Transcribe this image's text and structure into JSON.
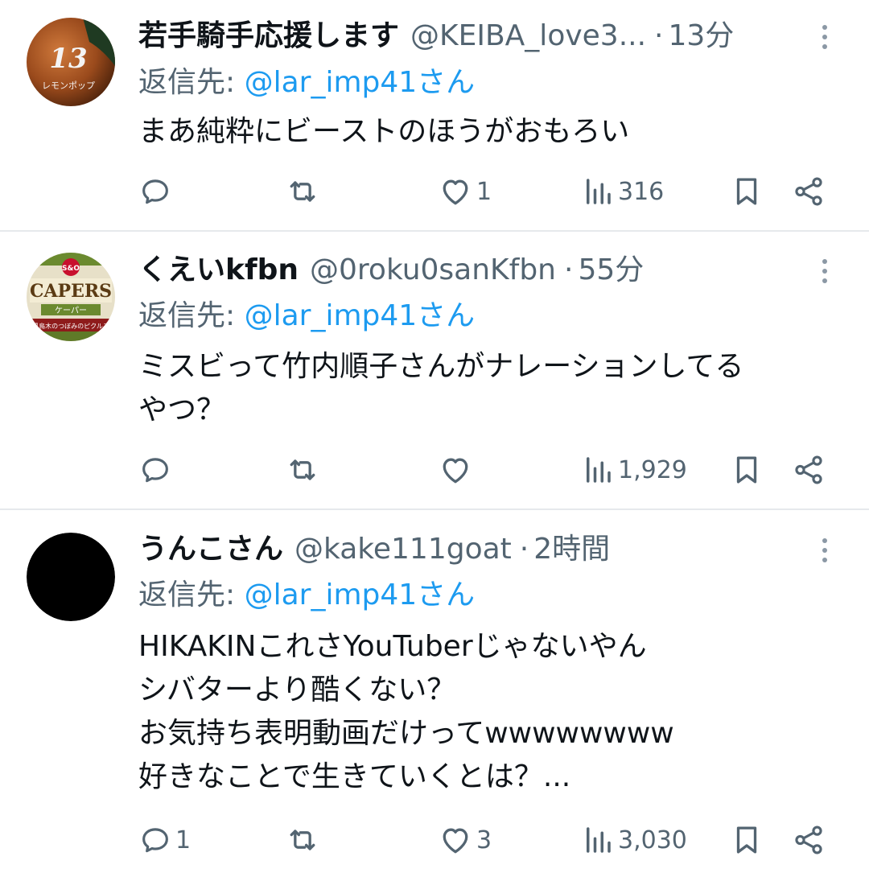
{
  "tweets": [
    {
      "display_name": "若手騎手応援します",
      "handle": "@KEIBA_love3...",
      "separator": "·",
      "time": "13分",
      "reply_label": "返信先: ",
      "reply_target": "@lar_imp41さん",
      "text": "まあ純粋にビーストのほうがおもろい",
      "replies": "",
      "retweets": "",
      "likes": "1",
      "views": "316",
      "avatar_icon": "jockey-helmet-avatar",
      "avatar_text_number": "13",
      "avatar_text_label": "レモンポップ"
    },
    {
      "display_name": "くえいkfbn",
      "handle": "@0roku0sanKfbn",
      "separator": "·",
      "time": "55分",
      "reply_label": "返信先: ",
      "reply_target": "@lar_imp41さん",
      "text": "ミスビって竹内順子さんがナレーションしてる\nやつ？",
      "replies": "",
      "retweets": "",
      "likes": "",
      "views": "1,929",
      "avatar_icon": "capers-jar-avatar",
      "avatar_text_brand": "S&O",
      "avatar_text_main": "CAPERS",
      "avatar_text_sub": "ケーパー",
      "avatar_text_small": "風鳥木のつぼみのピクルス"
    },
    {
      "display_name": "うんこさん",
      "handle": "@kake111goat",
      "separator": "·",
      "time": "2時間",
      "reply_label": "返信先: ",
      "reply_target": "@lar_imp41さん",
      "text": "HIKAKINこれさYouTuberじゃないやん\nシバターより酷くない？\nお気持ち表明動画だけってwwwwwwww\n好きなことで生きていくとは？...",
      "replies": "1",
      "retweets": "",
      "likes": "3",
      "views": "3,030",
      "avatar_icon": "black-circle-avatar"
    }
  ],
  "colors": {
    "text_primary": "#0f1419",
    "text_secondary": "#536471",
    "link": "#1d9bf0",
    "divider": "#e6e9ec"
  },
  "icons": [
    "reply-icon",
    "retweet-icon",
    "like-icon",
    "views-icon",
    "bookmark-icon",
    "share-icon",
    "more-icon"
  ]
}
